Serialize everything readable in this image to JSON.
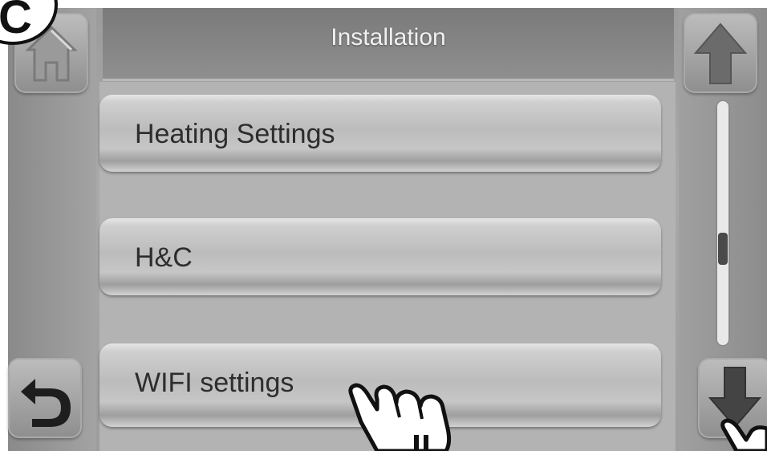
{
  "step": {
    "letter": "C"
  },
  "header": {
    "title": "Installation"
  },
  "menu": {
    "items": [
      {
        "label": "Heating Settings"
      },
      {
        "label": "H&C"
      },
      {
        "label": "WIFI settings"
      }
    ]
  },
  "navigation": {
    "home_icon": "home-icon",
    "back_icon": "back-arrow-icon",
    "up_icon": "up-arrow-icon",
    "down_icon": "down-arrow-icon"
  },
  "scrollbar": {
    "position_fraction": 0.62
  },
  "pointer": {
    "icon": "pointing-hand-icon"
  }
}
